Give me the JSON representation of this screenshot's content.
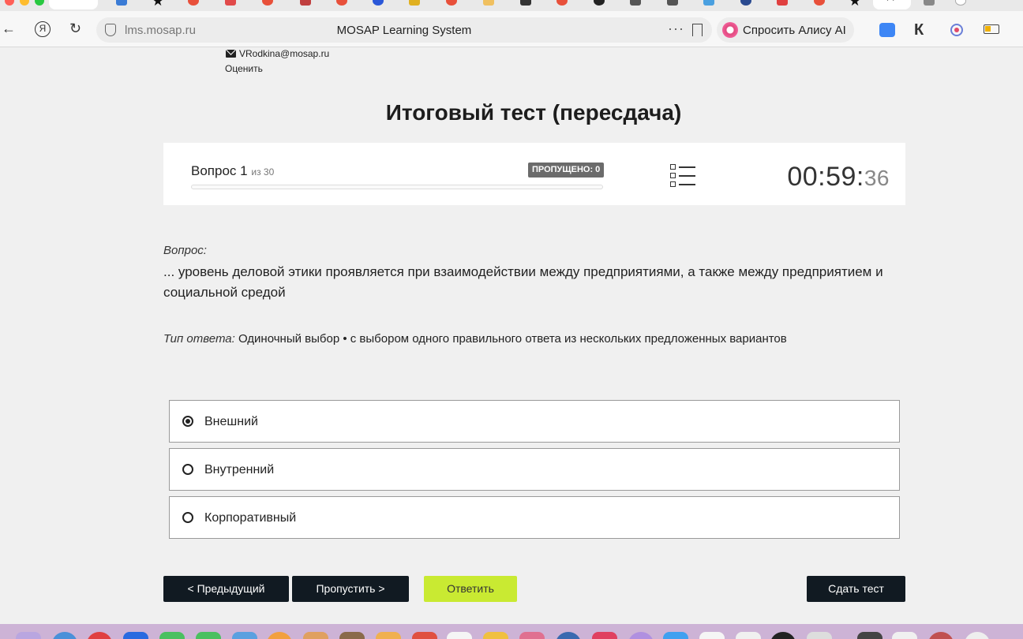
{
  "browser": {
    "active_tab_text": "28",
    "domain": "lms.mosap.ru",
    "page_title": "MOSAP Learning System",
    "alisa_label": "Спросить Алису AI"
  },
  "user": {
    "email": "VRodkina@mosap.ru",
    "rate_label": "Оценить"
  },
  "test": {
    "title": "Итоговый тест (пересдача)",
    "question_word": "Вопрос",
    "question_number": "1",
    "question_total_text": "из 30",
    "skipped_label": "ПРОПУЩЕНО: 0",
    "progress_fraction": 0,
    "timer_main": "00:59:",
    "timer_seconds": "36"
  },
  "question": {
    "caption": "Вопрос:",
    "text": "... уровень деловой этики проявляется при взаимодействии между предприятиями, а также между предприятием и социальной средой",
    "answer_type_label": "Тип ответа:",
    "answer_type_value": "Одиночный выбор • с выбором одного правильного ответа из нескольких предложенных вариантов"
  },
  "options": [
    {
      "label": "Внешний",
      "selected": true
    },
    {
      "label": "Внутренний",
      "selected": false
    },
    {
      "label": "Корпоративный",
      "selected": false
    }
  ],
  "buttons": {
    "prev": "< Предыдущий",
    "skip": "Пропустить >",
    "answer": "Ответить",
    "submit": "Сдать тест"
  },
  "colors": {
    "answer_button": "#c9ea32",
    "dark_button": "#111a22",
    "page_bg": "#f0f0f0"
  }
}
